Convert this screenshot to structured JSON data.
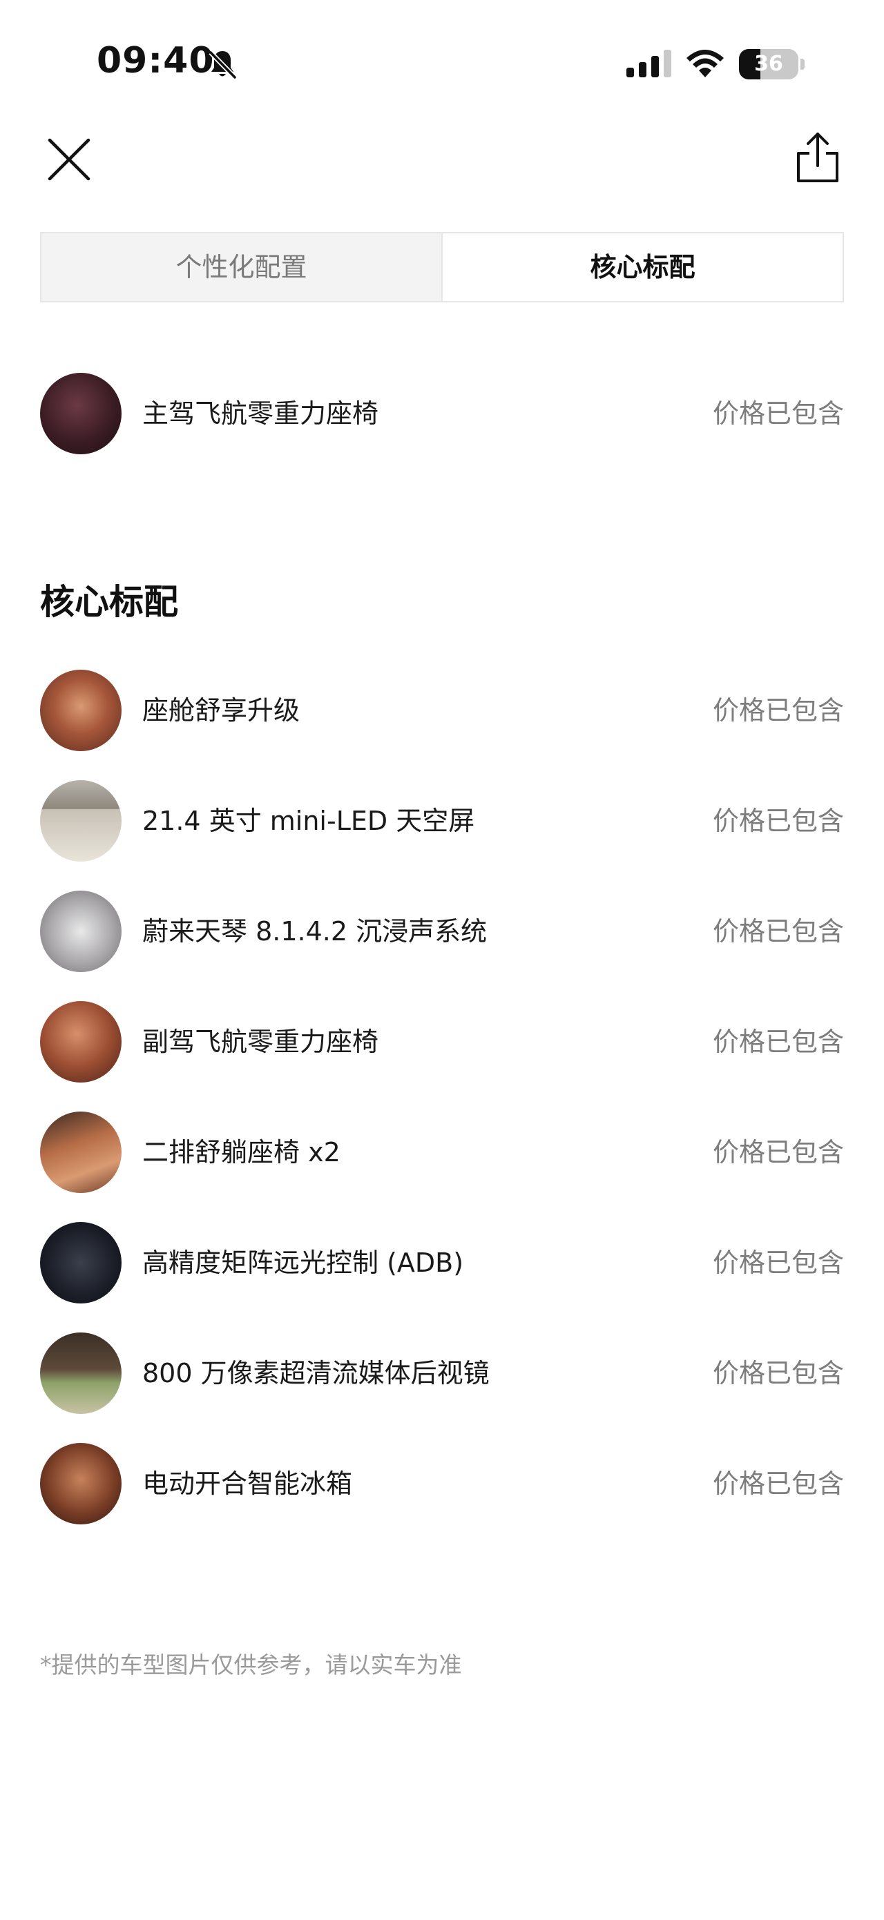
{
  "status_bar": {
    "time": "09:40",
    "battery": "36",
    "battery_level": 0.36,
    "icons": [
      "bell-slash-icon",
      "signal-icon",
      "wifi-icon",
      "battery-icon"
    ]
  },
  "nav": {
    "close_icon": "close-icon",
    "share_icon": "share-icon"
  },
  "tabs": [
    {
      "label": "个性化配置",
      "active": false
    },
    {
      "label": "核心标配",
      "active": true
    }
  ],
  "selected_items": [
    {
      "label": "主驾飞航零重力座椅",
      "price": "价格已包含",
      "thumb": "t-seat-dark"
    }
  ],
  "core_section": {
    "heading": "核心标配",
    "items": [
      {
        "label": "座舱舒享升级",
        "price": "价格已包含",
        "thumb": "t-cabin"
      },
      {
        "label": "21.4 英寸 mini-LED 天空屏",
        "price": "价格已包含",
        "thumb": "t-screen"
      },
      {
        "label": "蔚来天琴 8.1.4.2 沉浸声系统",
        "price": "价格已包含",
        "thumb": "t-car"
      },
      {
        "label": "副驾飞航零重力座椅",
        "price": "价格已包含",
        "thumb": "t-seat-brown"
      },
      {
        "label": "二排舒躺座椅 x2",
        "price": "价格已包含",
        "thumb": "t-seat-rear"
      },
      {
        "label": "高精度矩阵远光控制 (ADB)",
        "price": "价格已包含",
        "thumb": "t-key"
      },
      {
        "label": "800 万像素超清流媒体后视镜",
        "price": "价格已包含",
        "thumb": "t-mirror"
      },
      {
        "label": "电动开合智能冰箱",
        "price": "价格已包含",
        "thumb": "t-fridge"
      }
    ]
  },
  "disclaimer": "*提供的车型图片仅供参考，请以实车为准"
}
